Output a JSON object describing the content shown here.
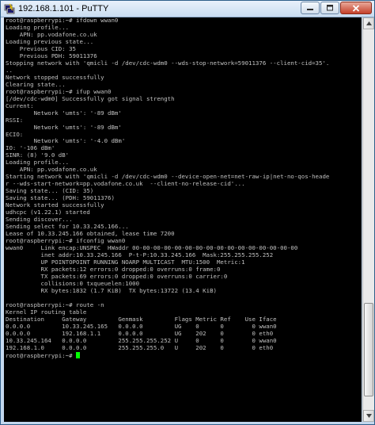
{
  "window": {
    "title": "192.168.1.101 - PuTTY",
    "icon": "putty-icon",
    "buttons": [
      "minimize-icon",
      "maximize-icon",
      "close-icon"
    ]
  },
  "terminal": {
    "lines": [
      "root@raspberrypi:~# ifdown wwan0",
      "Loading profile...",
      "    APN: pp.vodafone.co.uk",
      "Loading previous state...",
      "    Previous CID: 35",
      "    Previous PDH: 59011376",
      "Stopping network with 'qmicli -d /dev/cdc-wdm0 --wds-stop-network=59011376 --client-cid=35'.",
      "..",
      "Network stopped successfully",
      "Clearing state...",
      "root@raspberrypi:~# ifup wwan0",
      "[/dev/cdc-wdm0] Successfully got signal strength",
      "Current:",
      "        Network 'umts': '-89 dBm'",
      "RSSI:",
      "        Network 'umts': '-89 dBm'",
      "ECIO:",
      "        Network 'umts': '-4.0 dBm'",
      "IO: '-106 dBm'",
      "SINR: (8) '9.0 dB'",
      "Loading profile...",
      "    APN: pp.vodafone.co.uk",
      "Starting network with 'qmicli -d /dev/cdc-wdm0 --device-open-net=net-raw-ip|net-no-qos-heade",
      "r --wds-start-network=pp.vodafone.co.uk  --client-no-release-cid'...",
      "Saving state... (CID: 35)",
      "Saving state... (PDH: 59011376)",
      "Network started successfully",
      "udhcpc (v1.22.1) started",
      "Sending discover...",
      "Sending select for 10.33.245.166...",
      "Lease of 10.33.245.166 obtained, lease time 7200",
      "root@raspberrypi:~# ifconfig wwan0",
      "wwan0     Link encap:UNSPEC  HWaddr 00-00-00-00-00-00-00-00-00-00-00-00-00-00-00-00",
      "          inet addr:10.33.245.166  P-t-P:10.33.245.166  Mask:255.255.255.252",
      "          UP POINTOPOINT RUNNING NOARP MULTICAST  MTU:1500  Metric:1",
      "          RX packets:12 errors:0 dropped:0 overruns:0 frame:0",
      "          TX packets:69 errors:0 dropped:0 overruns:0 carrier:0",
      "          collisions:0 txqueuelen:1000",
      "          RX bytes:1832 (1.7 KiB)  TX bytes:13722 (13.4 KiB)",
      "",
      "root@raspberrypi:~# route -n",
      "Kernel IP routing table",
      "Destination     Gateway         Genmask         Flags Metric Ref    Use Iface",
      "0.0.0.0         10.33.245.165   0.0.0.0         UG    0      0        0 wwan0",
      "0.0.0.0         192.168.1.1     0.0.0.0         UG    202    0        0 eth0",
      "10.33.245.164   0.0.0.0         255.255.255.252 U     0      0        0 wwan0",
      "192.168.1.0     0.0.0.0         255.255.255.0   U     202    0        0 eth0",
      "root@raspberrypi:~# "
    ]
  }
}
